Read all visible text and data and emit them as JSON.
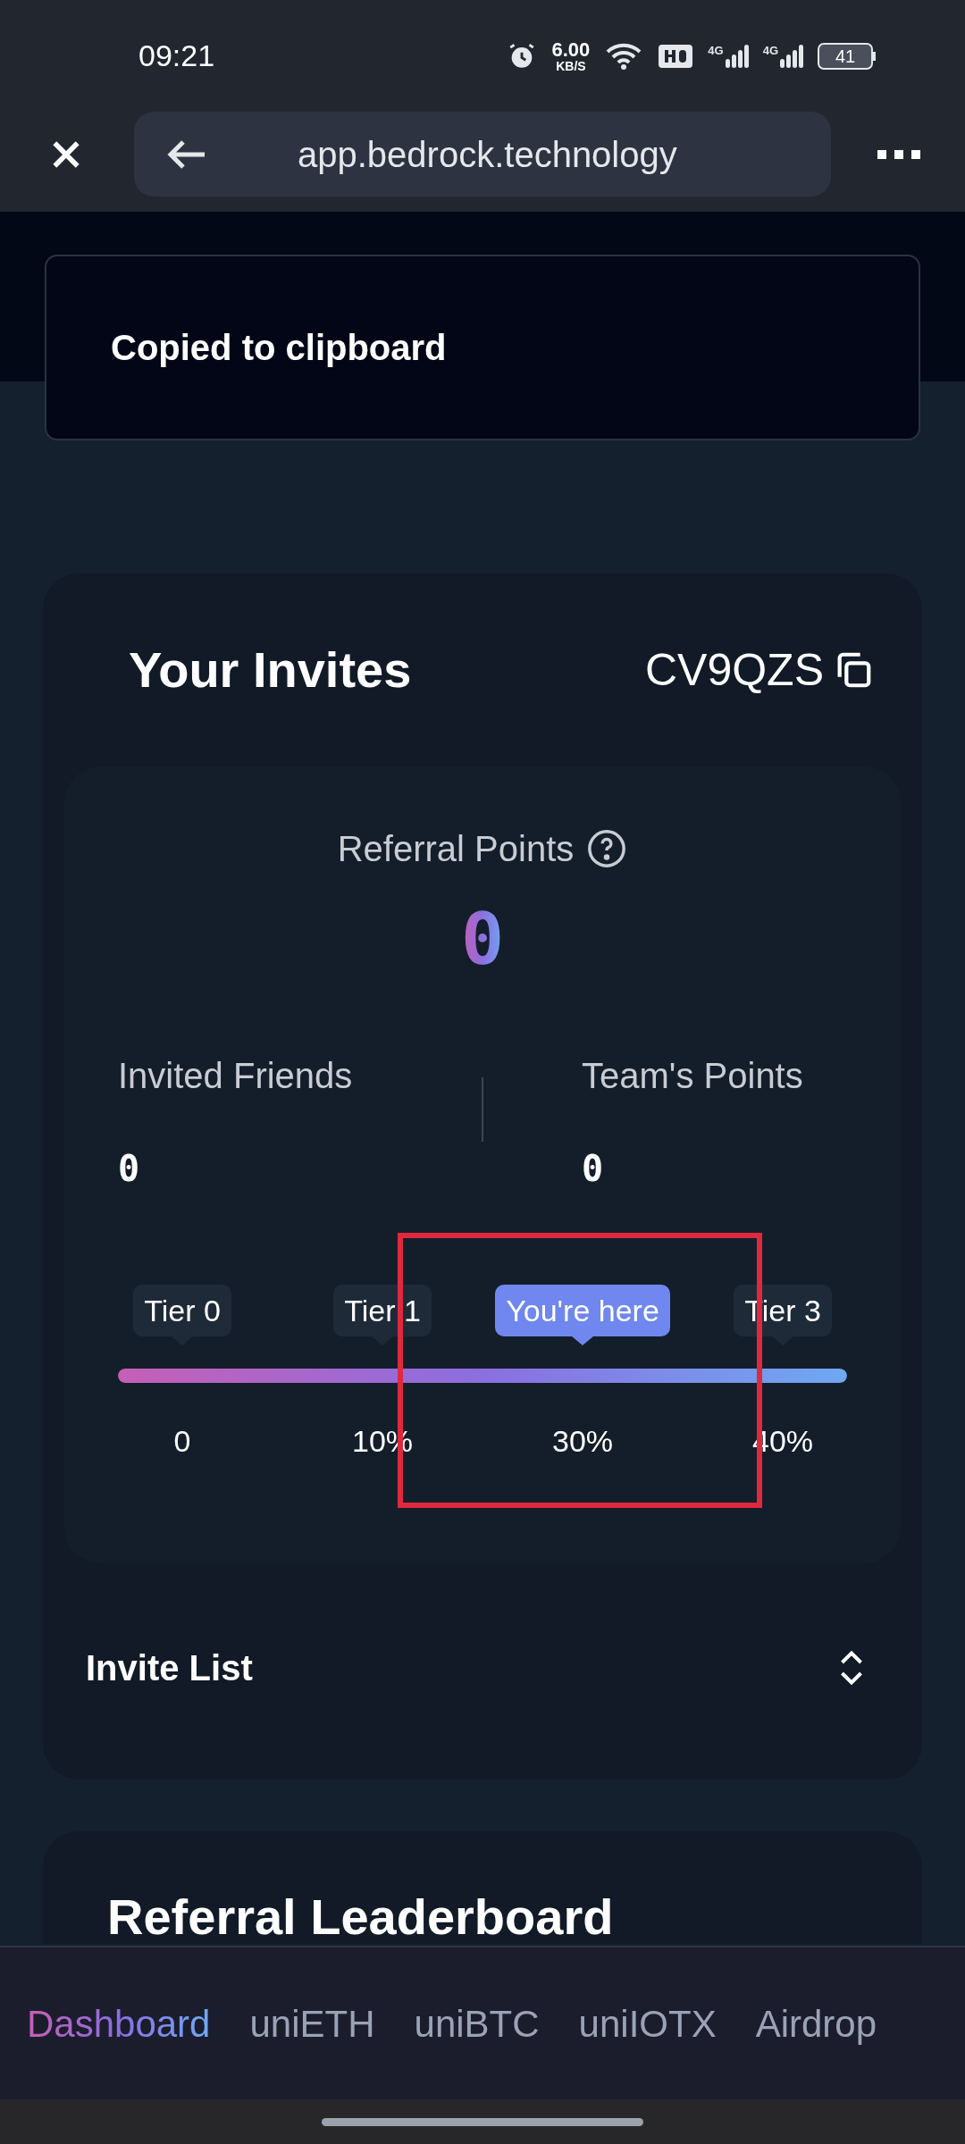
{
  "status_bar": {
    "time": "09:21",
    "speed": "6.00",
    "speed_unit": "KB/S",
    "networks": [
      "4G",
      "4G"
    ],
    "battery": "41"
  },
  "browser": {
    "url": "app.bedrock.technology"
  },
  "toast": {
    "message": "Copied to clipboard"
  },
  "invites": {
    "title": "Your Invites",
    "code": "CV9QZS",
    "points_label": "Referral Points",
    "points": "0",
    "stats": [
      {
        "label": "Invited Friends",
        "value": "0"
      },
      {
        "label": "Team's Points",
        "value": "0"
      }
    ],
    "tiers": [
      {
        "label": "Tier 0",
        "value": "0",
        "selected": false
      },
      {
        "label": "Tier 1",
        "value": "10%",
        "selected": false
      },
      {
        "label": "You're here",
        "value": "30%",
        "selected": true
      },
      {
        "label": "Tier 3",
        "value": "40%",
        "selected": false
      }
    ],
    "progress": {
      "level": 1
    },
    "invite_list": {
      "label": "Invite List"
    }
  },
  "leaderboard": {
    "title": "Referral Leaderboard"
  },
  "bottom_tabs": [
    {
      "label": "Dashboard",
      "selected": true
    },
    {
      "label": "uniETH",
      "selected": false
    },
    {
      "label": "uniBTC",
      "selected": false
    },
    {
      "label": "uniIOTX",
      "selected": false
    },
    {
      "label": "Airdrop",
      "selected": false
    }
  ]
}
